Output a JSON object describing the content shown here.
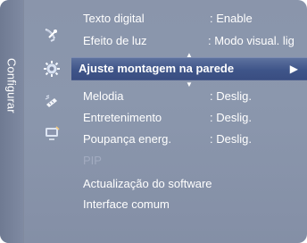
{
  "sidebar": {
    "title": "Configurar"
  },
  "menu": {
    "items": [
      {
        "label": "Texto digital",
        "value": ": Enable"
      },
      {
        "label": "Efeito de luz",
        "value": ": Modo visual. lig"
      },
      {
        "label": "Ajuste montagem na parede",
        "value": "",
        "selected": true
      },
      {
        "label": "Melodia",
        "value": ": Deslig."
      },
      {
        "label": "Entretenimento",
        "value": ": Deslig."
      },
      {
        "label": "Poupança energ.",
        "value": ": Deslig."
      },
      {
        "label": "PIP",
        "value": "",
        "disabled": true
      },
      {
        "label": "Actualização do software",
        "value": ""
      },
      {
        "label": "Interface comum",
        "value": ""
      }
    ],
    "selected_arrow": "▶",
    "scroll_up_indicator": "▲",
    "scroll_down_indicator": "▼"
  },
  "icons": [
    {
      "name": "satellite-dish-icon"
    },
    {
      "name": "gear-icon"
    },
    {
      "name": "remote-icon"
    },
    {
      "name": "input-icon"
    }
  ],
  "colors": {
    "panel": "#8b97ad",
    "selected_bar": "#3f5589",
    "text": "#ffffff",
    "disabled_text": "#a2abc0"
  }
}
